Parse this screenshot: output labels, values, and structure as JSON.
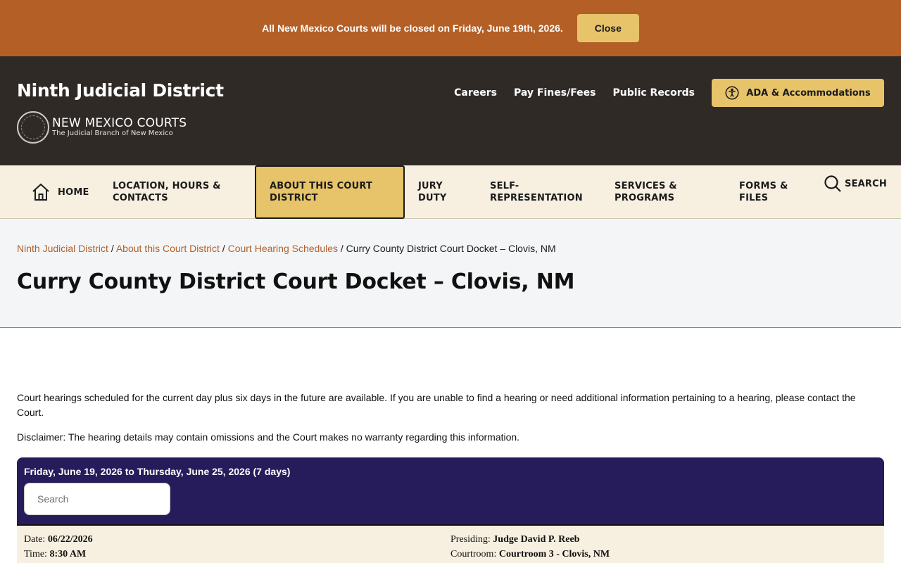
{
  "alert": {
    "message": "All New Mexico Courts will be closed on Friday, June 19th, 2026.",
    "close_label": "Close"
  },
  "header": {
    "site_title": "Ninth Judicial District",
    "logo_main": "NEW MEXICO COURTS",
    "logo_sub": "The Judicial Branch of New Mexico",
    "links": [
      "Careers",
      "Pay Fines/Fees",
      "Public Records"
    ],
    "ada_label": "ADA & Accommodations"
  },
  "nav": {
    "home": "HOME",
    "location": "LOCATION, HOURS & CONTACTS",
    "about": "ABOUT THIS COURT DISTRICT",
    "jury": "JURY DUTY",
    "self_rep": "SELF-REPRESENTATION",
    "services": "SERVICES & PROGRAMS",
    "forms": "FORMS & FILES",
    "search": "SEARCH"
  },
  "breadcrumb": {
    "crumbs": [
      "Ninth Judicial District",
      "About this Court District",
      "Court Hearing Schedules"
    ],
    "separator": " / ",
    "current": "Curry County District Court Docket – Clovis, NM"
  },
  "page": {
    "title": "Curry County District Court Docket – Clovis, NM",
    "intro": "Court hearings scheduled for the current day plus six days in the future are available. If you are unable to find a hearing or need additional information pertaining to a hearing, please contact the Court.",
    "disclaimer": "Disclaimer:  The hearing details may contain omissions and the Court makes no warranty regarding this information."
  },
  "docket": {
    "range": "Friday, June 19, 2026 to Thursday, June 25, 2026 (7 days)",
    "search_placeholder": "Search",
    "entries": [
      {
        "date_label": "Date:",
        "date": "06/22/2026",
        "time_label": "Time:",
        "time": "8:30 AM",
        "presiding_label": "Presiding:",
        "presiding": "Judge David P. Reeb",
        "courtroom_label": "Courtroom:",
        "courtroom": "Courtroom 3 - Clovis, NM"
      }
    ]
  },
  "colors": {
    "alert_bg": "#b35f26",
    "header_bg": "#302a27",
    "accent_gold": "#e7c46a",
    "nav_bg": "#f7efe0",
    "docket_header_bg": "#261c5c",
    "link": "#b35f26"
  }
}
